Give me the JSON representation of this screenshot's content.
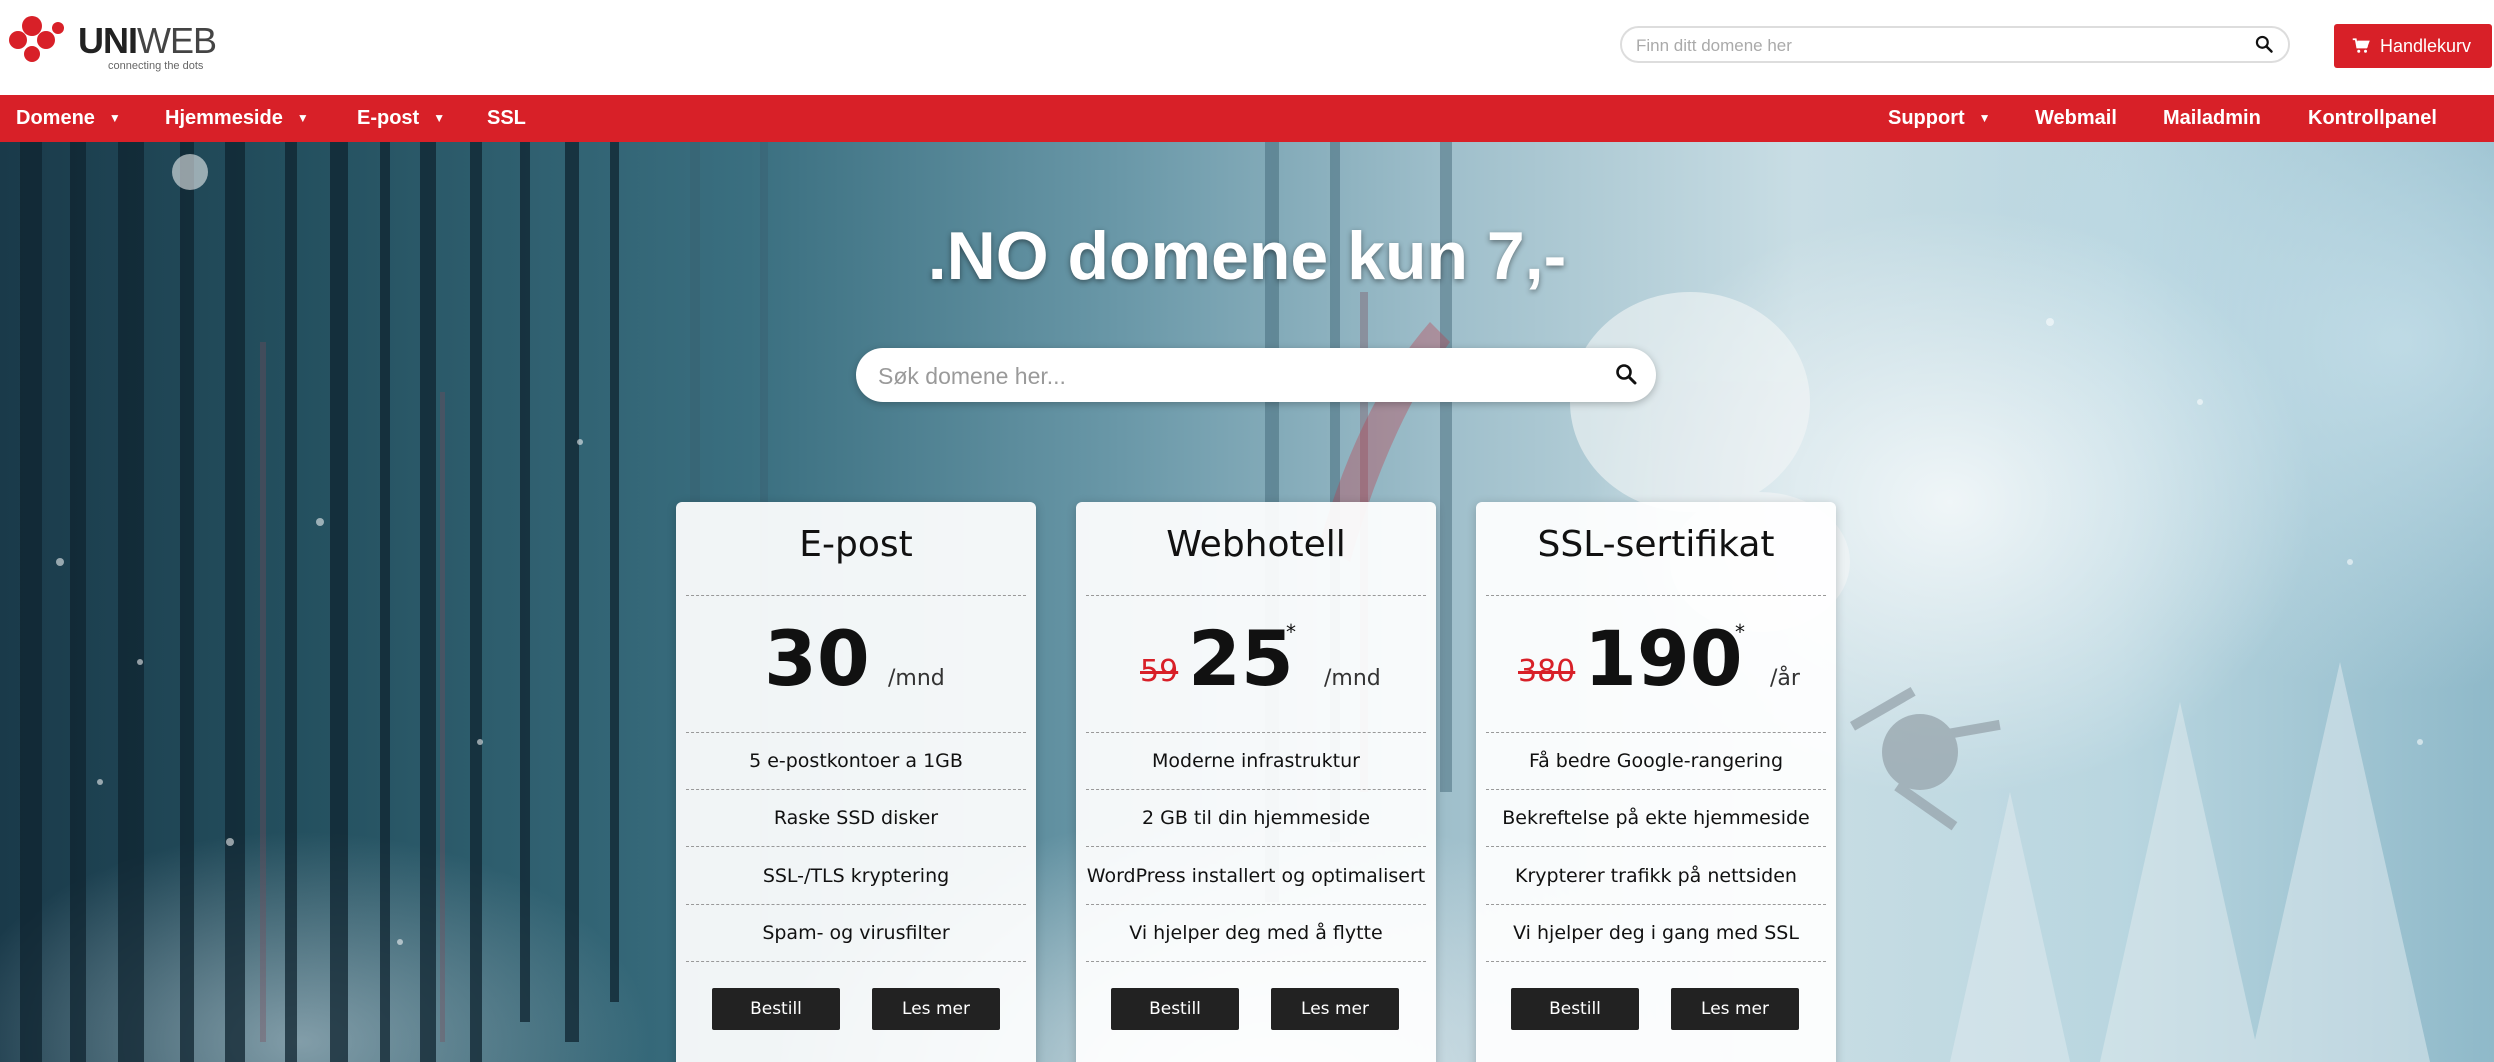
{
  "brand": {
    "name_bold": "UNI",
    "name_rest": "WEB",
    "tagline": "connecting the dots",
    "accent": "#d82028"
  },
  "header": {
    "search_placeholder": "Finn ditt domene her",
    "search_icon": "search-icon",
    "cart_label": "Handlekurv",
    "cart_icon": "cart-icon"
  },
  "nav": {
    "left": [
      {
        "label": "Domene",
        "dropdown": true
      },
      {
        "label": "Hjemmeside",
        "dropdown": true
      },
      {
        "label": "E-post",
        "dropdown": true
      },
      {
        "label": "SSL",
        "dropdown": false
      }
    ],
    "right": [
      {
        "label": "Support",
        "dropdown": true
      },
      {
        "label": "Webmail",
        "dropdown": false
      },
      {
        "label": "Mailadmin",
        "dropdown": false
      },
      {
        "label": "Kontrollpanel",
        "dropdown": false
      }
    ],
    "caret": "▼"
  },
  "hero": {
    "title": ".NO domene kun 7,-",
    "search_placeholder": "Søk domene her..."
  },
  "cards": [
    {
      "title": "E-post",
      "old_price": "",
      "price": "30",
      "star": "",
      "unit": "/mnd",
      "features": [
        "5 e-postkontoer a 1GB",
        "Raske SSD disker",
        "SSL-/TLS kryptering",
        "Spam- og virusfilter"
      ],
      "order_label": "Bestill",
      "more_label": "Les mer"
    },
    {
      "title": "Webhotell",
      "old_price": "59",
      "price": "25",
      "star": "*",
      "unit": "/mnd",
      "features": [
        "Moderne infrastruktur",
        "2 GB til din hjemmeside",
        "WordPress installert og optimalisert",
        "Vi hjelper deg med å flytte"
      ],
      "order_label": "Bestill",
      "more_label": "Les mer"
    },
    {
      "title": "SSL-sertifikat",
      "old_price": "380",
      "price": "190",
      "star": "*",
      "unit": "/år",
      "features": [
        "Få bedre Google-rangering",
        "Bekreftelse på ekte hjemmeside",
        "Krypterer trafikk på nettsiden",
        "Vi hjelper deg i gang med SSL"
      ],
      "order_label": "Bestill",
      "more_label": "Les mer"
    }
  ]
}
